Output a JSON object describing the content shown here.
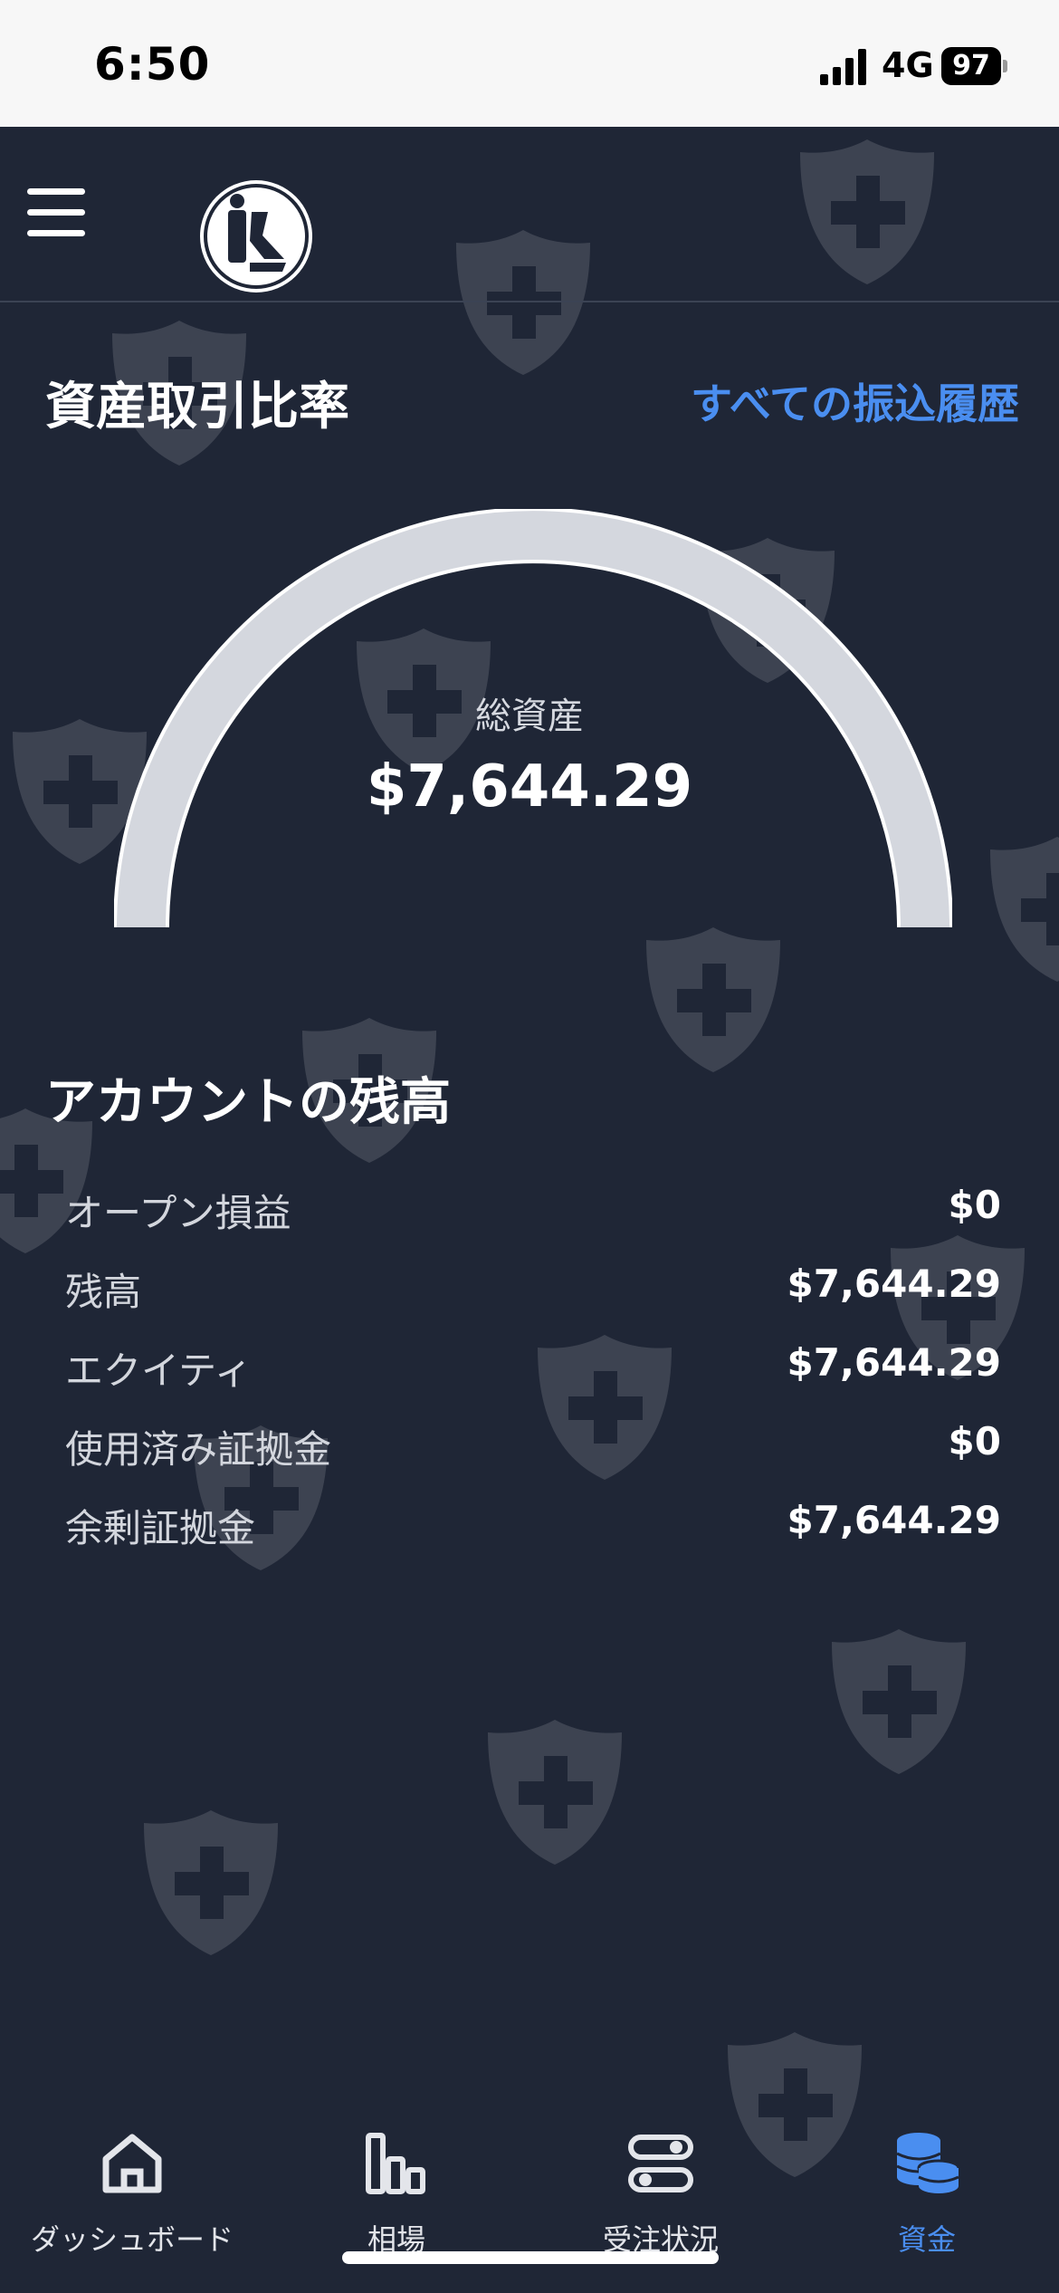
{
  "status_bar": {
    "time": "6:50",
    "network": "4G",
    "battery": "97"
  },
  "page": {
    "title": "資産取引比率",
    "history_link": "すべての振込履歴"
  },
  "gauge": {
    "label": "総資産",
    "value": "$7,644.29"
  },
  "balances": {
    "title": "アカウントの残高",
    "rows": [
      {
        "label": "オープン損益",
        "value": "$0"
      },
      {
        "label": "残高",
        "value": "$7,644.29"
      },
      {
        "label": "エクイティ",
        "value": "$7,644.29"
      },
      {
        "label": "使用済み証拠金",
        "value": "$0"
      },
      {
        "label": "余剰証拠金",
        "value": "$7,644.29"
      }
    ]
  },
  "nav": {
    "items": [
      {
        "label": "ダッシュボード",
        "icon": "home-icon"
      },
      {
        "label": "相場",
        "icon": "bar-chart-icon"
      },
      {
        "label": "受注状況",
        "icon": "toggles-icon"
      },
      {
        "label": "資金",
        "icon": "coins-icon",
        "active": true
      }
    ]
  },
  "colors": {
    "background": "#1f2636",
    "accent": "#4a8ef0",
    "gauge": "#d4d7de"
  }
}
